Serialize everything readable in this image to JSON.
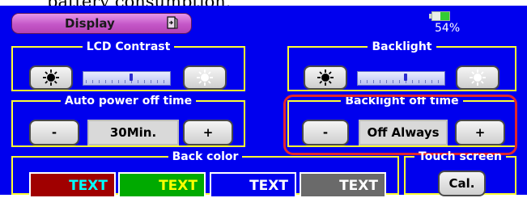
{
  "caption_fragment": "battery consumption.",
  "header": {
    "title": "Display",
    "icon": "exit-door-icon"
  },
  "battery": {
    "level_percent": 54,
    "label": "54%",
    "fill_color": "#33cc33"
  },
  "lcd_contrast": {
    "legend": "LCD Contrast",
    "decrease_icon": "sun-dark-icon",
    "increase_icon": "sun-bright-icon",
    "level_fraction": 0.55
  },
  "backlight": {
    "legend": "Backlight",
    "decrease_icon": "sun-dark-icon",
    "increase_icon": "sun-bright-icon",
    "level_fraction": 0.55
  },
  "auto_power_off": {
    "legend": "Auto power off time",
    "minus": "-",
    "value": "30Min.",
    "plus": "+"
  },
  "backlight_off": {
    "legend": "Backlight off time",
    "minus": "-",
    "value": "Off Always",
    "plus": "+",
    "highlighted": true
  },
  "back_color": {
    "legend": "Back color",
    "swatches": [
      {
        "text": "TEXT",
        "background": "#a00000",
        "text_color": "#00ffff"
      },
      {
        "text": "TEXT",
        "background": "#00aa00",
        "text_color": "#ffff00"
      },
      {
        "text": "TEXT",
        "background": "#0000ee",
        "text_color": "#ffffff"
      },
      {
        "text": "TEXT",
        "background": "#6a6a6a",
        "text_color": "#ffffff"
      }
    ]
  },
  "touch_screen": {
    "legend": "Touch screen",
    "button": "Cal."
  },
  "colors": {
    "screen_bg": "#0000ee",
    "frame": "#ffff33",
    "highlight": "#e3262b"
  }
}
